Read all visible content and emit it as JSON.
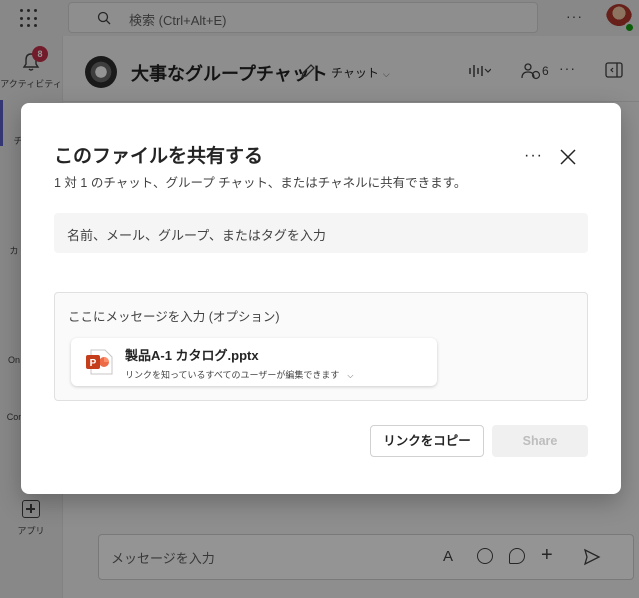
{
  "topbar": {
    "search_placeholder": "検索 (Ctrl+Alt+E)",
    "more_label": "···"
  },
  "rail": {
    "activity_label": "アクティビティ",
    "activity_badge": "8",
    "apps_label": "アプリ",
    "partial_labels": [
      "チ",
      "カ",
      "On",
      "Con"
    ]
  },
  "chat": {
    "title": "大事なグループチャット",
    "tab_label": "チャット",
    "participant_count": "6",
    "more_label": "···",
    "composer_placeholder": "メッセージを入力"
  },
  "dialog": {
    "title": "このファイルを共有する",
    "subtitle": "1 対 1 のチャット、グループ チャット、またはチャネルに共有できます。",
    "more_label": "···",
    "recipient_placeholder": "名前、メール、グループ、またはタグを入力",
    "message_placeholder": "ここにメッセージを入力 (オプション)",
    "file": {
      "name": "製品A-1 カタログ.pptx",
      "permission": "リンクを知っているすべてのユーザーが編集できます"
    },
    "copy_link_label": "リンクをコピー",
    "share_label": "Share"
  },
  "colors": {
    "accent": "#5b5fc7",
    "badge": "#c4314b",
    "powerpoint": "#c43e1c",
    "presence": "#13a10e"
  }
}
